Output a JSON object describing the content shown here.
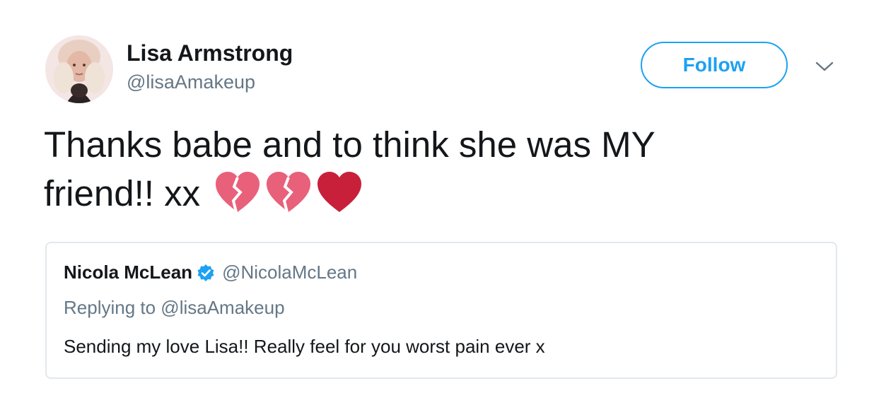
{
  "tweet": {
    "author": {
      "name": "Lisa Armstrong",
      "handle": "@lisaAmakeup",
      "avatar_icon": "profile-photo"
    },
    "follow_label": "Follow",
    "more_icon": "chevron-down-icon",
    "text_line1": "Thanks babe and to think she was MY",
    "text_line2": "friend!! xx",
    "emojis": [
      "broken-heart",
      "broken-heart",
      "red-heart"
    ]
  },
  "quote": {
    "name": "Nicola McLean",
    "verified_icon": "verified-badge-icon",
    "handle": "@NicolaMcLean",
    "reply_to": "Replying to @lisaAmakeup",
    "text": "Sending my love Lisa!! Really feel for you worst pain ever x"
  },
  "colors": {
    "accent": "#1da1f2",
    "text_primary": "#14171a",
    "text_secondary": "#657786",
    "border": "#e1e8ed",
    "broken_heart": "#e8607a",
    "red_heart": "#c8203a"
  }
}
